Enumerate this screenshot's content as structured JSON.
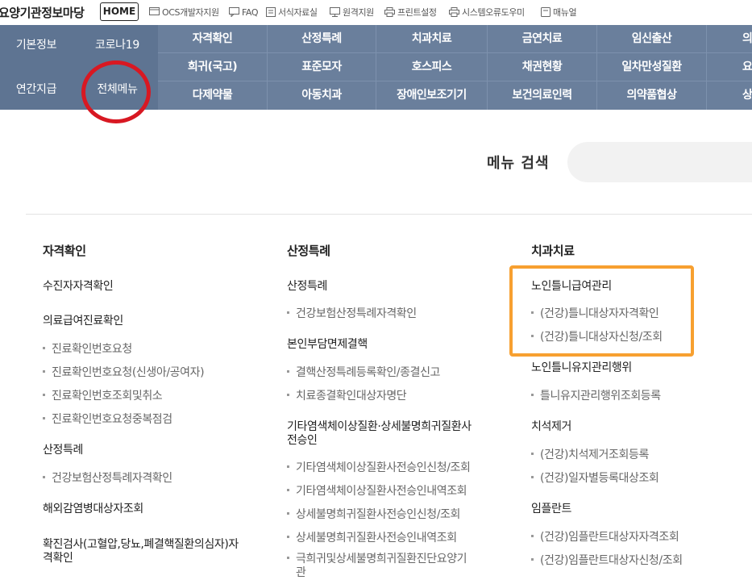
{
  "header": {
    "site_title": "요양기관정보마당",
    "home_label": "HOME",
    "utility_links": [
      {
        "label": "OCS개발자지원",
        "icon": "monitor-icon"
      },
      {
        "label": "FAQ",
        "icon": "chat-icon"
      },
      {
        "label": "서식자료실",
        "icon": "document-icon"
      },
      {
        "label": "원격지원",
        "icon": "desktop-icon"
      },
      {
        "label": "프린트설정",
        "icon": "printer-icon"
      },
      {
        "label": "시스템오류도우미",
        "icon": "printer-icon"
      },
      {
        "label": "매뉴얼",
        "icon": "manual-icon"
      }
    ]
  },
  "gnb": {
    "left": [
      "기본정보",
      "코로나19",
      "연간지급",
      "전체메뉴"
    ],
    "rows": [
      [
        "자격확인",
        "산정특례",
        "치과치료",
        "금연치료",
        "임신출산",
        "의"
      ],
      [
        "희귀(국고)",
        "표준모자",
        "호스피스",
        "채권현황",
        "일차만성질환",
        "요"
      ],
      [
        "다제약물",
        "아동치과",
        "장애인보조기기",
        "보건의료인력",
        "의약품협상",
        "상"
      ]
    ]
  },
  "search": {
    "title": "메뉴 검색",
    "placeholder": ""
  },
  "menu": {
    "col1": {
      "title": "자격확인",
      "sub1": "수진자자격확인",
      "sub2": "의료급여진료확인",
      "sub2_items": [
        "진료확인번호요청",
        "진료확인번호요청(신생아/공여자)",
        "진료확인번호조회및취소",
        "진료확인번호요청중복점검"
      ],
      "sub3": "산정특례",
      "sub3_items": [
        "건강보험산정특례자격확인"
      ],
      "sub4": "해외감염병대상자조회",
      "sub5_line1": "확진검사(고혈압,당뇨,폐결핵질환의심자)자",
      "sub5_line2": "격확인"
    },
    "col2": {
      "title": "산정특례",
      "sub1": "산정특례",
      "sub1_items": [
        "건강보험산정특례자격확인"
      ],
      "sub2": "본인부담면제결핵",
      "sub2_items": [
        "결핵산정특례등록확인/종결신고",
        "치료종결확인대상자명단"
      ],
      "sub3_line1": "기타염색체이상질환·상세불명희귀질환사",
      "sub3_line2": "전승인",
      "sub3_items": [
        "기타염색체이상질환사전승인신청/조회",
        "기타염색체이상질환사전승인내역조회",
        "상세불명희귀질환사전승인신청/조회",
        "상세불명희귀질환사전승인내역조회"
      ],
      "sub3_last_line1": "극희귀및상세불명희귀질환진단요양기",
      "sub3_last_line2": "관"
    },
    "col3": {
      "title": "치과치료",
      "sub1": "노인틀니급여관리",
      "sub1_items": [
        "(건강)틀니대상자자격확인",
        "(건강)틀니대상자신청/조회"
      ],
      "sub2": "노인틀니유지관리행위",
      "sub2_items": [
        "틀니유지관리행위조회등록"
      ],
      "sub3": "치석제거",
      "sub3_items": [
        "(건강)치석제거조회등록",
        "(건강)일자별등록대상조회"
      ],
      "sub4": "임플란트",
      "sub4_items": [
        "(건강)임플란트대상자자격조회",
        "(건강)임플란트대상자신청/조회"
      ]
    }
  },
  "colors": {
    "gnb_bg": "#6a7f9c",
    "highlight_red": "#d81822",
    "highlight_orange": "#f7a030"
  }
}
